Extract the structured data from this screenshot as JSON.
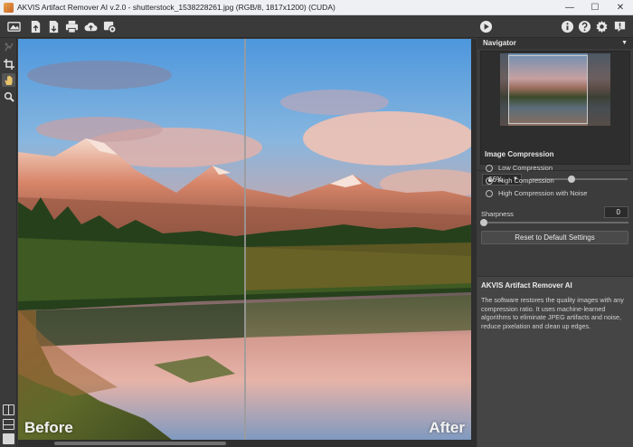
{
  "window": {
    "title": "AKVIS Artifact Remover AI v.2.0 - shutterstock_1538228261.jpg (RGB/8, 1817x1200) (CUDA)",
    "minimize": "—",
    "maximize": "☐",
    "close": "✕"
  },
  "toolbar": {
    "left": [
      "home-icon",
      "open-file-icon",
      "save-file-icon",
      "print-icon",
      "share-cloud-icon",
      "batch-settings-icon"
    ],
    "run": "play-icon",
    "right": [
      "info-icon",
      "help-icon",
      "gear-icon",
      "notification-icon"
    ]
  },
  "tools": [
    "clone-tool-icon",
    "crop-icon",
    "hand-icon",
    "zoom-icon"
  ],
  "canvas": {
    "before_label": "Before",
    "after_label": "After"
  },
  "navigator": {
    "title": "Navigator",
    "zoom": "66%"
  },
  "compression": {
    "title": "Image Compression",
    "options": [
      {
        "label": "Low Compression",
        "selected": false
      },
      {
        "label": "High Compression",
        "selected": true
      },
      {
        "label": "High Compression with Noise",
        "selected": false
      }
    ]
  },
  "sharpness": {
    "label": "Sharpness",
    "value": "0"
  },
  "reset_label": "Reset to Default Settings",
  "info": {
    "title": "AKVIS Artifact Remover AI",
    "text": "The software restores the quality images with any compression ratio. It uses machine-learned algorithms to eliminate JPEG artifacts and noise, reduce pixelation and clean up edges."
  },
  "colors": {
    "panel": "#3c3c3c",
    "titlebar": "#eef0f3",
    "accent": "#e8a44a"
  }
}
